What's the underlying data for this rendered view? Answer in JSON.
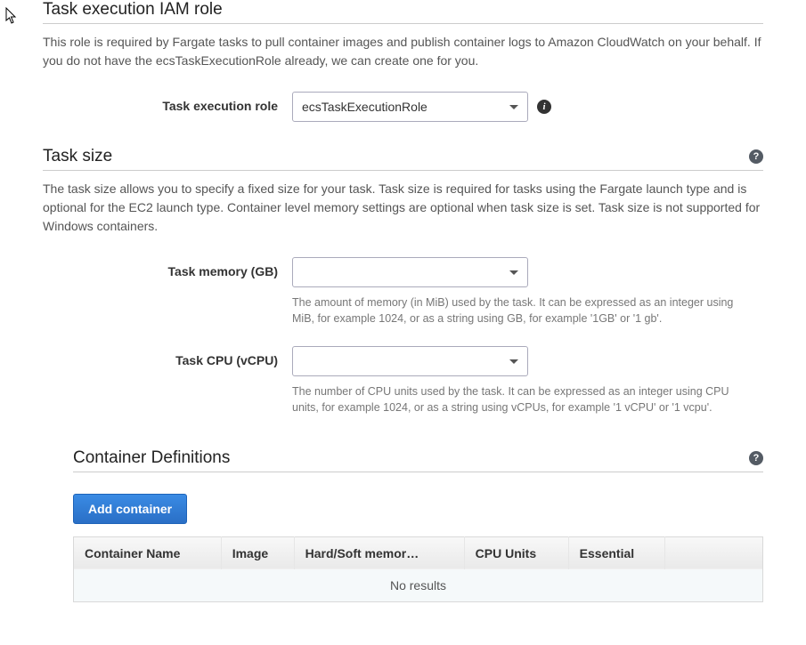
{
  "iam": {
    "title": "Task execution IAM role",
    "desc": "This role is required by Fargate tasks to pull container images and publish container logs to Amazon CloudWatch on your behalf. If you do not have the ecsTaskExecutionRole already, we can create one for you.",
    "label": "Task execution role",
    "value": "ecsTaskExecutionRole"
  },
  "size": {
    "title": "Task size",
    "desc": "The task size allows you to specify a fixed size for your task. Task size is required for tasks using the Fargate launch type and is optional for the EC2 launch type. Container level memory settings are optional when task size is set. Task size is not supported for Windows containers.",
    "memory": {
      "label": "Task memory (GB)",
      "value": "",
      "hint": "The amount of memory (in MiB) used by the task. It can be expressed as an integer using MiB, for example 1024, or as a string using GB, for example '1GB' or '1 gb'."
    },
    "cpu": {
      "label": "Task CPU (vCPU)",
      "value": "",
      "hint": "The number of CPU units used by the task. It can be expressed as an integer using CPU units, for example 1024, or as a string using vCPUs, for example '1 vCPU' or '1 vcpu'."
    }
  },
  "containers": {
    "title": "Container Definitions",
    "add_label": "Add container",
    "columns": {
      "name": "Container Name",
      "image": "Image",
      "memory": "Hard/Soft memor…",
      "cpu": "CPU Units",
      "essential": "Essential"
    },
    "no_results": "No results"
  }
}
